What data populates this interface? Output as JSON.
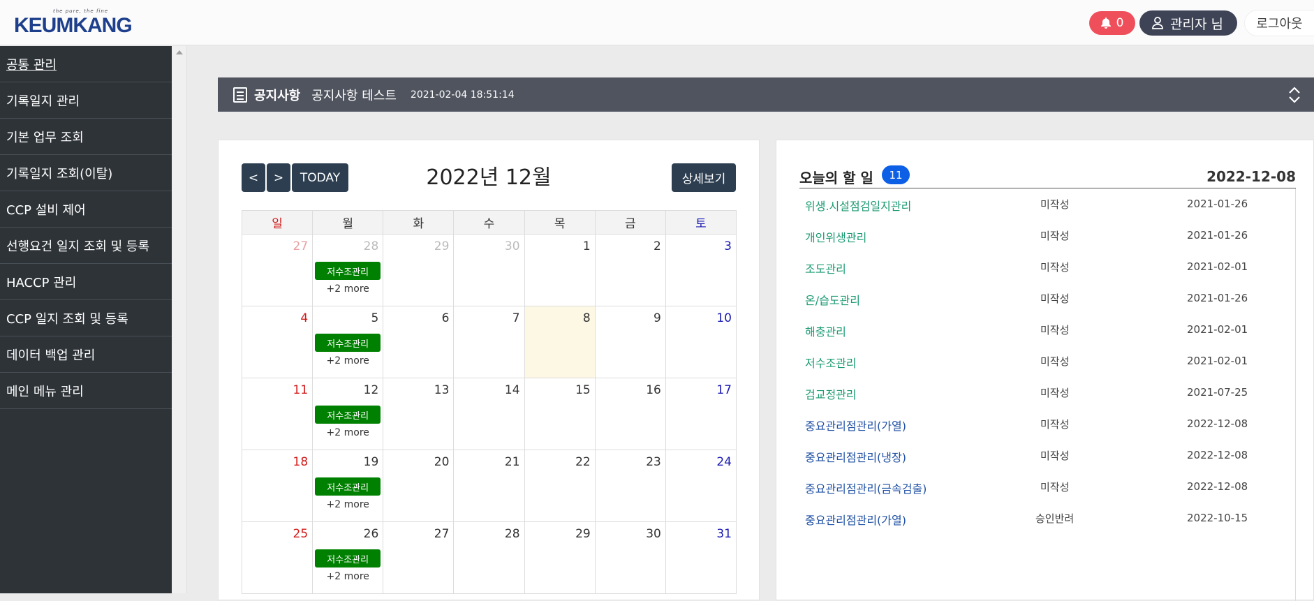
{
  "header": {
    "logo_tagline": "the pure, the fine",
    "logo_text": "KEUMKANG",
    "notification_count": "0",
    "admin_label": "관리자 님",
    "logout_label": "로그아웃"
  },
  "sidebar": {
    "items": [
      {
        "label": "공통 관리"
      },
      {
        "label": "기록일지 관리"
      },
      {
        "label": "기본 업무 조회"
      },
      {
        "label": "기록일지 조회(이탈)"
      },
      {
        "label": "CCP 설비 제어"
      },
      {
        "label": "선행요건 일지 조회 및 등록"
      },
      {
        "label": "HACCP 관리"
      },
      {
        "label": "CCP 일지 조회 및 등록"
      },
      {
        "label": "데이터 백업 관리"
      },
      {
        "label": "메인 메뉴 관리"
      }
    ]
  },
  "notice": {
    "title": "공지사항",
    "text": "공지사항 테스트",
    "date": "2021-02-04 18:51:14"
  },
  "calendar": {
    "prev_label": "<",
    "next_label": ">",
    "today_label": "TODAY",
    "title": "2022년 12월",
    "detail_label": "상세보기",
    "weekdays": [
      "일",
      "월",
      "화",
      "수",
      "목",
      "금",
      "토"
    ],
    "weeks": [
      [
        {
          "d": "27",
          "other": true
        },
        {
          "d": "28",
          "other": true,
          "ev": "저수조관리",
          "more": "+2 more"
        },
        {
          "d": "29",
          "other": true
        },
        {
          "d": "30",
          "other": true
        },
        {
          "d": "1"
        },
        {
          "d": "2"
        },
        {
          "d": "3"
        }
      ],
      [
        {
          "d": "4"
        },
        {
          "d": "5",
          "ev": "저수조관리",
          "more": "+2 more"
        },
        {
          "d": "6"
        },
        {
          "d": "7"
        },
        {
          "d": "8",
          "today": true
        },
        {
          "d": "9"
        },
        {
          "d": "10"
        }
      ],
      [
        {
          "d": "11"
        },
        {
          "d": "12",
          "ev": "저수조관리",
          "more": "+2 more"
        },
        {
          "d": "13"
        },
        {
          "d": "14"
        },
        {
          "d": "15"
        },
        {
          "d": "16"
        },
        {
          "d": "17"
        }
      ],
      [
        {
          "d": "18"
        },
        {
          "d": "19",
          "ev": "저수조관리",
          "more": "+2 more"
        },
        {
          "d": "20"
        },
        {
          "d": "21"
        },
        {
          "d": "22"
        },
        {
          "d": "23"
        },
        {
          "d": "24"
        }
      ],
      [
        {
          "d": "25"
        },
        {
          "d": "26",
          "ev": "저수조관리",
          "more": "+2 more"
        },
        {
          "d": "27"
        },
        {
          "d": "28"
        },
        {
          "d": "29"
        },
        {
          "d": "30"
        },
        {
          "d": "31"
        }
      ]
    ]
  },
  "todo": {
    "title": "오늘의 할 일",
    "count": "11",
    "date": "2022-12-08",
    "items": [
      {
        "name": "위생.시설점검일지관리",
        "status": "미작성",
        "date": "2021-01-26",
        "color": "green"
      },
      {
        "name": "개인위생관리",
        "status": "미작성",
        "date": "2021-01-26",
        "color": "green"
      },
      {
        "name": "조도관리",
        "status": "미작성",
        "date": "2021-02-01",
        "color": "green"
      },
      {
        "name": "온/습도관리",
        "status": "미작성",
        "date": "2021-01-26",
        "color": "green"
      },
      {
        "name": "해충관리",
        "status": "미작성",
        "date": "2021-02-01",
        "color": "green"
      },
      {
        "name": "저수조관리",
        "status": "미작성",
        "date": "2021-02-01",
        "color": "green"
      },
      {
        "name": "검교정관리",
        "status": "미작성",
        "date": "2021-07-25",
        "color": "green"
      },
      {
        "name": "중요관리점관리(가열)",
        "status": "미작성",
        "date": "2022-12-08",
        "color": "blue"
      },
      {
        "name": "중요관리점관리(냉장)",
        "status": "미작성",
        "date": "2022-12-08",
        "color": "blue"
      },
      {
        "name": "중요관리점관리(금속검출)",
        "status": "미작성",
        "date": "2022-12-08",
        "color": "blue"
      },
      {
        "name": "중요관리점관리(가열)",
        "status": "승인반려",
        "date": "2022-10-15",
        "color": "blue"
      }
    ]
  }
}
